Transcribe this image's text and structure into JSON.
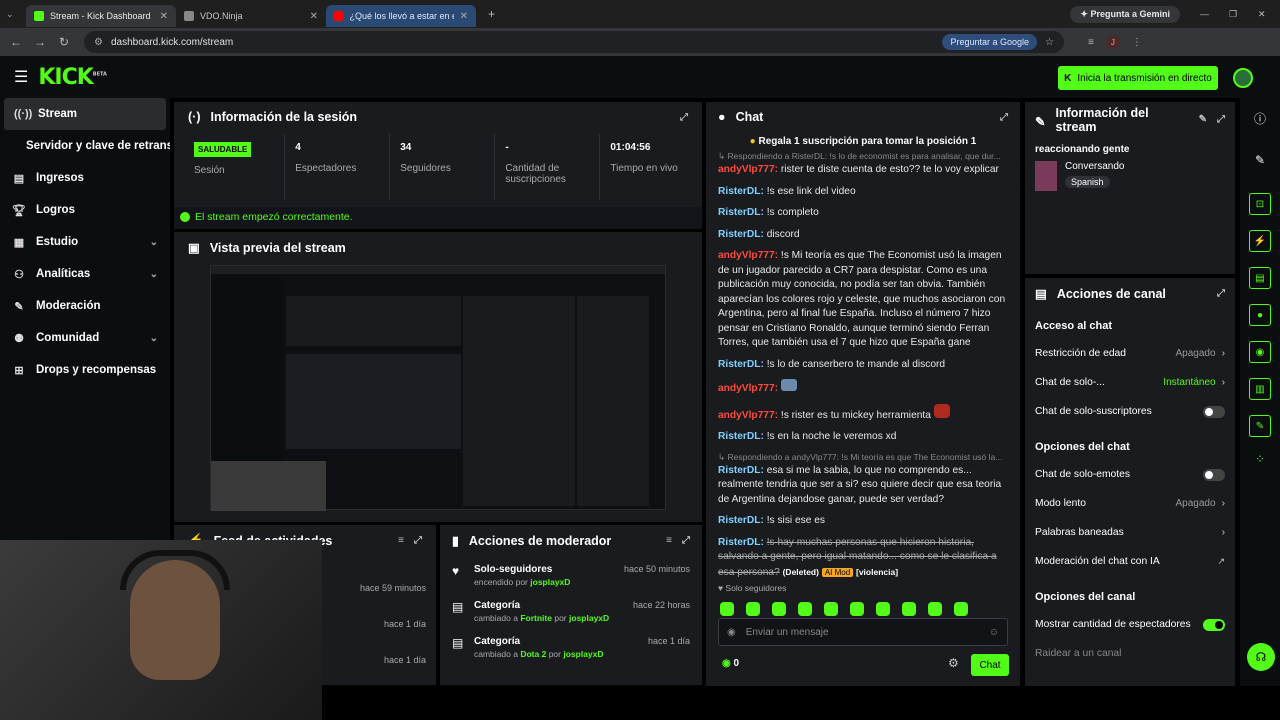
{
  "browser": {
    "tabs": [
      {
        "title": "Stream - Kick Dashboard"
      },
      {
        "title": "VDO.Ninja"
      },
      {
        "title": "¿Qué los llevó a estar en el infie"
      }
    ],
    "gemini": "Pregunta a Gemini",
    "url": "dashboard.kick.com/stream",
    "google_pill": "Preguntar a Google"
  },
  "header": {
    "logo": "KICK",
    "beta": "BETA",
    "go_live": "Inicia la transmisión en directo"
  },
  "nav": {
    "items": [
      {
        "label": "Stream"
      },
      {
        "label": "Servidor y clave de retransm"
      },
      {
        "label": "Ingresos"
      },
      {
        "label": "Logros"
      },
      {
        "label": "Estudio"
      },
      {
        "label": "Analíticas"
      },
      {
        "label": "Moderación"
      },
      {
        "label": "Comunidad"
      },
      {
        "label": "Drops y recompensas"
      }
    ]
  },
  "session": {
    "title": "Información de la sesión",
    "status_badge": "SALUDABLE",
    "status_label": "Sesión",
    "viewers_value": "4",
    "viewers_label": "Espectadores",
    "followers_value": "34",
    "followers_label": "Seguidores",
    "subs_value": "-",
    "subs_label": "Cantidad de suscripciones",
    "uptime_value": "01:04:56",
    "uptime_label": "Tiempo en vivo",
    "ok_message": "El stream empezó correctamente."
  },
  "preview": {
    "title": "Vista previa del stream"
  },
  "feed": {
    "title": "Feed de actividades",
    "times": [
      "hace 59 minutos",
      "hace 1 día",
      "hace 1 día"
    ]
  },
  "modactions": {
    "title": "Acciones de moderador",
    "items": [
      {
        "title": "Solo-seguidores",
        "sub": "encendido por",
        "user": "josplayxD",
        "time": "hace 50 minutos"
      },
      {
        "title": "Categoría",
        "sub": "cambiado a",
        "target": "Fortnite",
        "by": "por",
        "user": "josplayxD",
        "time": "hace 22 horas"
      },
      {
        "title": "Categoría",
        "sub": "cambiado a",
        "target": "Dota 2",
        "by": "por",
        "user": "josplayxD",
        "time": "hace 1 día"
      }
    ]
  },
  "chat": {
    "title": "Chat",
    "pinned": "Regala 1 suscripción para tomar la posición 1",
    "reply1": "Respondiendo a RisterDL: !s lo de economist es para analisar, que dur...",
    "m1_user": "andyVlp777:",
    "m1_text": "rister te diste cuenta de esto?? te lo voy explicar",
    "m2_user": "RisterDL:",
    "m2_text": "!s ese link del video",
    "m3_user": "RisterDL:",
    "m3_text": "!s completo",
    "m4_user": "RisterDL:",
    "m4_text": "discord",
    "m5_user": "andyVlp777:",
    "m5_text": "!s Mi teoría es que The Economist usó la imagen de un jugador parecido a CR7 para despistar. Como es una publicación muy conocida, no podía ser tan obvia. También aparecían los colores rojo y celeste, que muchos asociaron con Argentina, pero al final fue España. Incluso el número 7 hizo pensar en Cristiano Ronaldo, aunque terminó siendo Ferran Torres, que también usa el 7 que hizo que España gane",
    "m6_user": "RisterDL:",
    "m6_text": "!s lo de canserbero te mande al discord",
    "m7_user": "andyVlp777:",
    "m7_text": "",
    "m8_user": "andyVlp777:",
    "m8_text": "!s rister es tu mickey herramienta",
    "m9_user": "RisterDL:",
    "m9_text": "!s en la noche le veremos xd",
    "reply2": "Respondiendo a andyVlp777: !s Mi teoría es que The Economist usó la...",
    "m10_user": "RisterDL:",
    "m10_text": "esa si me la sabia, lo que no comprendo es... realmente tendria que ser a si? eso quiere decir que esa teoria de Argentina dejandose ganar, puede ser verdad?",
    "m11_user": "RisterDL:",
    "m11_text": "!s sisi ese es",
    "m12_user": "RisterDL:",
    "m12_text": "!s hay muchas personas que hicieron historia, salvando a gente, pero igual matando... como se le clasifica a esa persona?",
    "deleted": "(Deleted)",
    "ai_mod": "AI Mod",
    "violence": "[violencia]",
    "followers_only": "Solo seguidores",
    "input_placeholder": "Enviar un mensaje",
    "points": "0",
    "send": "Chat"
  },
  "stream_info": {
    "title": "Información del stream",
    "stream_title": "reaccionando gente",
    "category": "Conversando",
    "language": "Spanish"
  },
  "channel_actions": {
    "title": "Acciones de canal",
    "chat_access": "Acceso al chat",
    "age_restriction": "Restricción de edad",
    "age_value": "Apagado",
    "followers_chat": "Chat de solo-...",
    "followers_value": "Instantáneo",
    "subs_chat": "Chat de solo-suscriptores",
    "chat_options": "Opciones del chat",
    "emotes_chat": "Chat de solo-emotes",
    "slow_mode": "Modo lento",
    "slow_value": "Apagado",
    "banned_words": "Palabras baneadas",
    "ai_mod": "Moderación del chat con IA",
    "channel_options": "Opciones del canal",
    "show_viewers": "Mostrar cantidad de espectadores",
    "raid": "Raidear a un canal"
  }
}
